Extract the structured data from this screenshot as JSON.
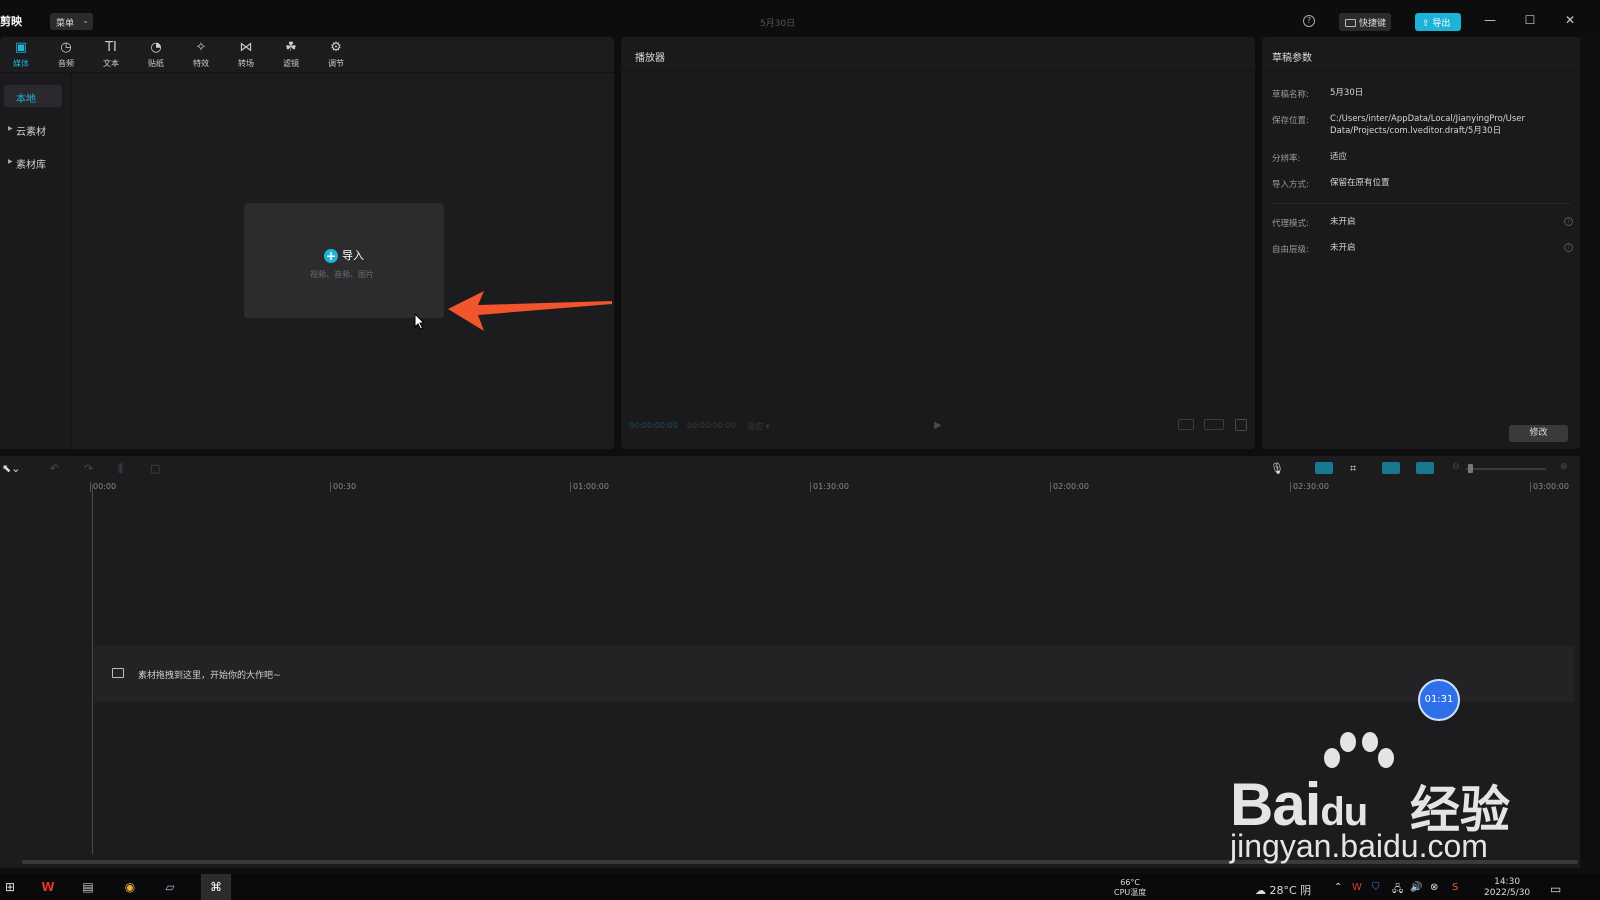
{
  "titlebar": {
    "app_name": "剪映",
    "menu_label": "菜单",
    "draft_title": "5月30日",
    "shortcut_label": "快捷键",
    "export_label": "导出"
  },
  "toolbar": {
    "tools": [
      {
        "label": "媒体",
        "icon": "media-icon"
      },
      {
        "label": "音频",
        "icon": "audio-icon"
      },
      {
        "label": "文本",
        "icon": "text-icon"
      },
      {
        "label": "贴纸",
        "icon": "sticker-icon"
      },
      {
        "label": "特效",
        "icon": "effects-icon"
      },
      {
        "label": "转场",
        "icon": "transition-icon"
      },
      {
        "label": "滤镜",
        "icon": "filter-icon"
      },
      {
        "label": "调节",
        "icon": "adjust-icon"
      }
    ]
  },
  "sidebar": {
    "items": [
      {
        "label": "本地"
      },
      {
        "label": "云素材"
      },
      {
        "label": "素材库"
      }
    ]
  },
  "import": {
    "title": "导入",
    "subtitle": "视频、音频、图片"
  },
  "player": {
    "title": "播放器",
    "current_time": "00:00:00:00",
    "total_time": "00:00:00:00",
    "ratio": "适应"
  },
  "params": {
    "title": "草稿参数",
    "rows": [
      {
        "label": "草稿名称:",
        "value": "5月30日"
      },
      {
        "label": "保存位置:",
        "value": "C:/Users/inter/AppData/Local/JianyingPro/User Data/Projects/com.lveditor.draft/5月30日"
      },
      {
        "label": "分辨率:",
        "value": "适应"
      },
      {
        "label": "导入方式:",
        "value": "保留在原有位置"
      },
      {
        "label": "代理模式:",
        "value": "未开启"
      },
      {
        "label": "自由层级:",
        "value": "未开启"
      }
    ],
    "modify_label": "修改"
  },
  "timeline": {
    "ticks": [
      "00:00",
      "00:30",
      "01:00:00",
      "01:30:00",
      "02:00:00",
      "02:30:00",
      "03:00:00"
    ],
    "track_hint": "素材拖拽到这里，开始你的大作吧~",
    "timer": "01:31"
  },
  "watermark": {
    "brand": "Bai",
    "brand_du": "du",
    "brand_cn": "经验",
    "url": "jingyan.baidu.com"
  },
  "taskbar": {
    "cpu_temp": "66°C",
    "cpu_label": "CPU温度",
    "weather": "28°C 阴",
    "time": "14:30",
    "date": "2022/5/30"
  },
  "colors": {
    "accent": "#1fb4d8",
    "export": "#1bb3d6",
    "arrow": "#f2552c",
    "timer_badge": "#2f6fe8"
  }
}
